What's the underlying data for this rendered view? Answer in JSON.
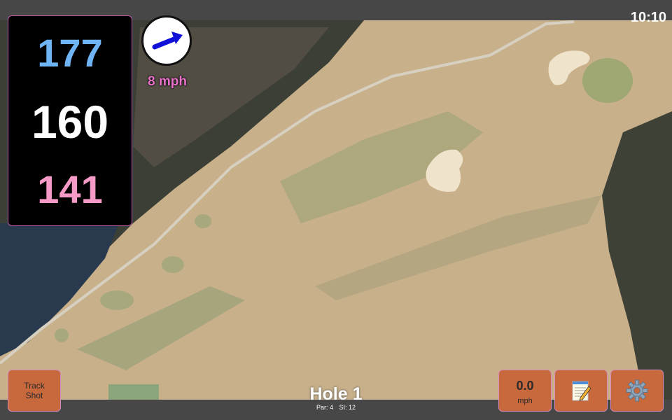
{
  "status_bar": {
    "time": "10:10"
  },
  "distances": {
    "back": "177",
    "middle": "160",
    "front": "141"
  },
  "wind": {
    "speed": "8 mph",
    "direction": "east-northeast"
  },
  "hole": {
    "title": "Hole 1",
    "par_label": "Par: 4",
    "si_label": "SI: 12"
  },
  "buttons": {
    "track_shot": "Track\nShot",
    "speed_value": "0.0",
    "speed_unit": "mph",
    "notes_icon": "notepad-icon",
    "settings_icon": "gear-icon"
  },
  "colors": {
    "back": "#6fb4f5",
    "middle": "#ffffff",
    "front": "#f59ac7",
    "button": "#c8683d",
    "wind_arrow": "#1010d8",
    "wind_text": "#e872c9"
  }
}
